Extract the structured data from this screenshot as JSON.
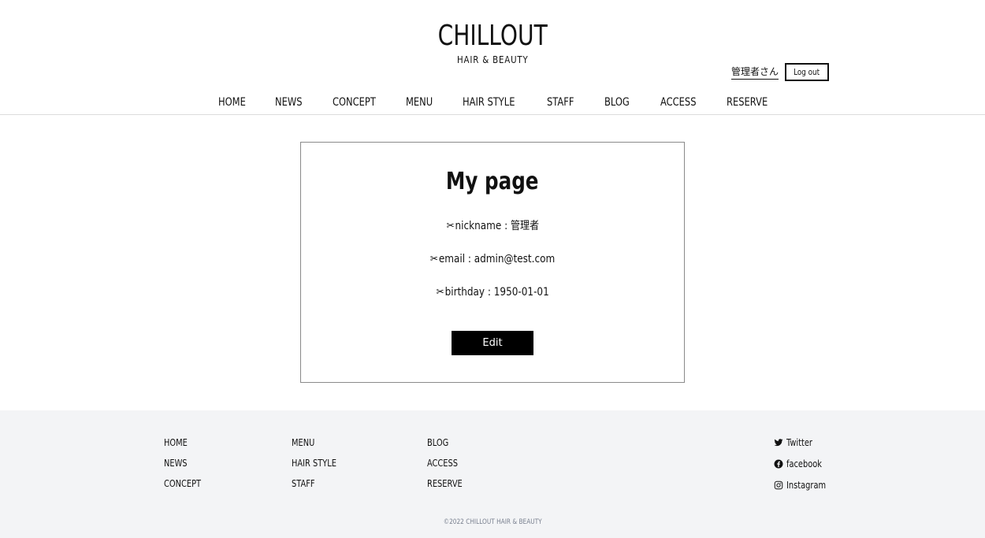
{
  "header": {
    "logo_title": "CHILLOUT",
    "logo_subtitle": "HAIR & BEAUTY",
    "user_name": "管理者さん",
    "logout_label": "Log out"
  },
  "nav": {
    "items": [
      "HOME",
      "NEWS",
      "CONCEPT",
      "MENU",
      "HAIR STYLE",
      "STAFF",
      "BLOG",
      "ACCESS",
      "RESERVE"
    ]
  },
  "mypage": {
    "title": "My page",
    "icon": "scissors-icon",
    "nickname_label": "nickname",
    "nickname_value": "管理者",
    "email_label": "email",
    "email_value": "admin@test.com",
    "birthday_label": "birthday",
    "birthday_value": "1950-01-01",
    "separator": " : ",
    "edit_label": "Edit"
  },
  "footer": {
    "col1": [
      "HOME",
      "NEWS",
      "CONCEPT"
    ],
    "col2": [
      "MENU",
      "HAIR STYLE",
      "STAFF"
    ],
    "col3": [
      "BLOG",
      "ACCESS",
      "RESERVE"
    ],
    "social": [
      {
        "icon": "twitter-icon",
        "label": "Twitter"
      },
      {
        "icon": "facebook-icon",
        "label": "facebook"
      },
      {
        "icon": "instagram-icon",
        "label": "Instagram"
      }
    ],
    "copyright": "©2022 CHILLOUT HAIR & BEAUTY"
  },
  "colors": {
    "footer_bg": "#f3f4f6",
    "button_bg": "#000000",
    "text": "#111111",
    "copyright": "#7a8190"
  }
}
